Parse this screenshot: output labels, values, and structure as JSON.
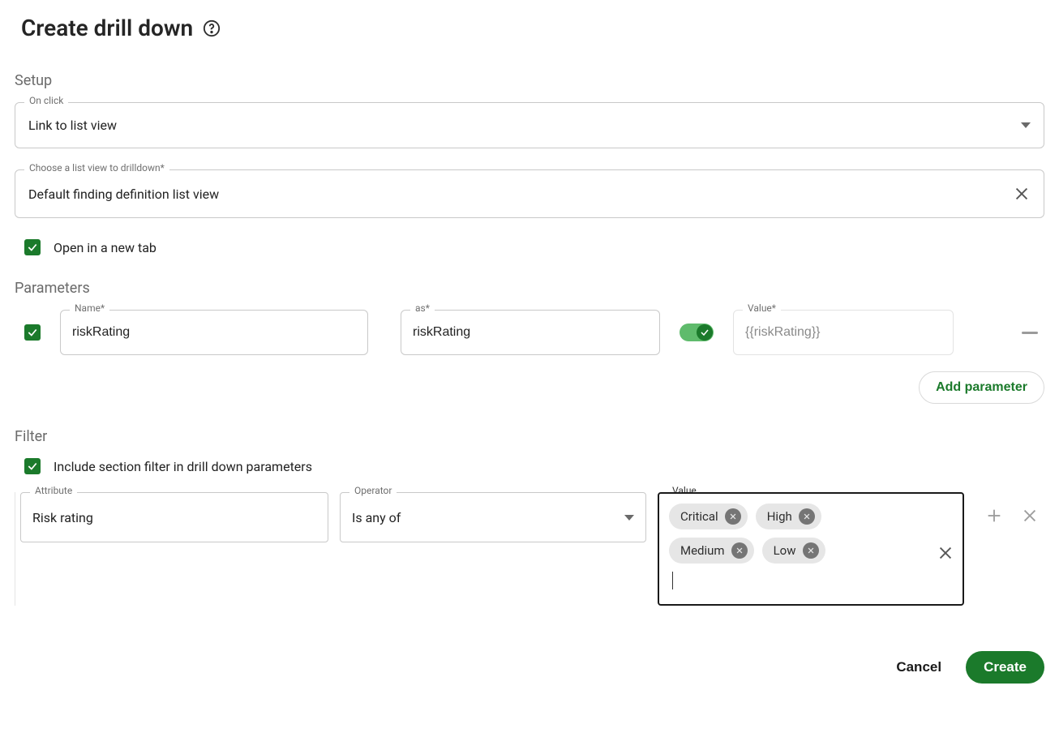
{
  "header": {
    "title": "Create drill down"
  },
  "setup": {
    "section_label": "Setup",
    "on_click": {
      "label": "On click",
      "value": "Link to list view"
    },
    "listview": {
      "label": "Choose a list view to drilldown*",
      "value": "Default finding definition list view"
    },
    "open_new_tab_label": "Open in a new tab"
  },
  "parameters": {
    "section_label": "Parameters",
    "name_label": "Name*",
    "as_label": "as*",
    "value_label": "Value*",
    "rows": [
      {
        "name": "riskRating",
        "as": "riskRating",
        "value": "{{riskRating}}"
      }
    ],
    "add_button_label": "Add parameter"
  },
  "filter": {
    "section_label": "Filter",
    "include_label": "Include section filter in drill down parameters",
    "attribute_label": "Attribute",
    "operator_label": "Operator",
    "value_label": "Value",
    "row": {
      "attribute": "Risk rating",
      "operator": "Is any of",
      "values": [
        "Critical",
        "High",
        "Medium",
        "Low"
      ]
    }
  },
  "footer": {
    "cancel": "Cancel",
    "create": "Create"
  }
}
